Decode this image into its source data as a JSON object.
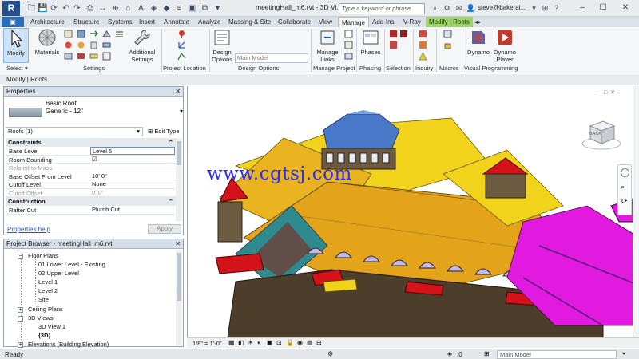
{
  "titlebar": {
    "app_icon_text": "R",
    "doc_title": "meetingHall_m6.rvt - 3D Vi...",
    "search_placeholder": "Type a keyword or phrase",
    "user": "steve@bakerai..."
  },
  "tabs": [
    {
      "label": "Architecture"
    },
    {
      "label": "Structure"
    },
    {
      "label": "Systems"
    },
    {
      "label": "Insert"
    },
    {
      "label": "Annotate"
    },
    {
      "label": "Analyze"
    },
    {
      "label": "Massing & Site"
    },
    {
      "label": "Collaborate"
    },
    {
      "label": "View"
    },
    {
      "label": "Manage"
    },
    {
      "label": "Add-Ins"
    },
    {
      "label": "V-Ray"
    },
    {
      "label": "Modify | Roofs"
    }
  ],
  "ribbon": {
    "modify": "Modify",
    "materials": "Materials",
    "additional_settings_1": "Additional",
    "additional_settings_2": "Settings",
    "design_options_1": "Design",
    "design_options_2": "Options",
    "main_model": "Main Model",
    "manage_links_1": "Manage",
    "manage_links_2": "Links",
    "phases": "Phases",
    "dynamo": "Dynamo",
    "dynamo_player_1": "Dynamo",
    "dynamo_player_2": "Player",
    "panels": {
      "select": "Select",
      "settings": "Settings",
      "project_location": "Project Location",
      "design_options": "Design Options",
      "manage_project": "Manage Project",
      "phasing": "Phasing",
      "selection": "Selection",
      "inquiry": "Inquiry",
      "macros": "Macros",
      "visual_programming": "Visual Programming"
    }
  },
  "optbar": {
    "label": "Modify | Roofs"
  },
  "properties": {
    "title": "Properties",
    "type_name": "Basic Roof",
    "type_sub": "Generic - 12\"",
    "instance_filter": "Roofs (1)",
    "edit_type": "Edit Type",
    "groups": {
      "constraints": "Constraints",
      "construction": "Construction"
    },
    "constraints_rows": [
      {
        "key": "Base Level",
        "value": "Level 5"
      },
      {
        "key": "Room Bounding",
        "value": "☑"
      },
      {
        "key": "Related to Mass",
        "value": ""
      },
      {
        "key": "Base Offset From Level",
        "value": "10'  0\""
      },
      {
        "key": "Cutoff Level",
        "value": "None"
      },
      {
        "key": "Cutoff Offset",
        "value": "0'  0\""
      }
    ],
    "construction_rows": [
      {
        "key": "Rafter Cut",
        "value": "Plumb Cut"
      }
    ],
    "help": "Properties help",
    "apply": "Apply"
  },
  "browser": {
    "title": "Project Browser - meetingHall_m6.rvt",
    "items": [
      {
        "label": "Floor Plans"
      },
      {
        "label": "01 Lower Level - Existing"
      },
      {
        "label": "02 Upper Level"
      },
      {
        "label": "Level 1"
      },
      {
        "label": "Level 2"
      },
      {
        "label": "Site"
      },
      {
        "label": "Ceiling Plans"
      },
      {
        "label": "3D Views"
      },
      {
        "label": "3D View 1"
      },
      {
        "label": "{3D}"
      },
      {
        "label": "Elevations (Building Elevation)"
      }
    ]
  },
  "viewcube": {
    "label": "BACK"
  },
  "viewctl": {
    "scale": "1/8\" = 1'-0\""
  },
  "status": {
    "text": "Ready",
    "zero": ":0",
    "model": "Main Model"
  },
  "watermark": "www.cgtsj.com"
}
